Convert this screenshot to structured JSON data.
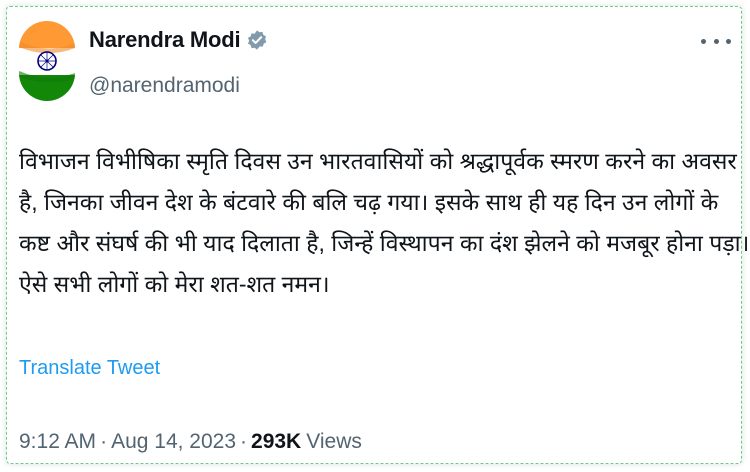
{
  "author": {
    "name": "Narendra Modi",
    "handle": "@narendramodi"
  },
  "tweet": {
    "lines": [
      "विभाजन विभीषिका स्मृति दिवस उन भारतवासियों को श्रद्धापूर्वक स्मरण करने का अवसर",
      "है, जिनका जीवन देश के बंटवारे की बलि चढ़ गया। इसके साथ ही यह दिन उन लोगों के",
      "कष्ट और संघर्ष की भी याद दिलाता है, जिन्हें विस्थापन का दंश झेलने को मजबूर होना पड़ा।",
      "ऐसे सभी लोगों को मेरा शत-शत नमन।"
    ],
    "translate_label": "Translate Tweet"
  },
  "meta": {
    "time": "9:12 AM",
    "date": "Aug 14, 2023",
    "views_count": "293K",
    "views_label": "Views"
  },
  "icons": {
    "verified": "verified-badge-icon",
    "more": "more-options-icon"
  },
  "colors": {
    "link_blue": "#1d9bf0",
    "secondary_text": "#536471",
    "primary_text": "#0f1419",
    "verified_grey": "#829aab",
    "saffron": "#ff9933",
    "green": "#138808",
    "chakra_navy": "#000080",
    "card_border": "#7cc38d"
  }
}
